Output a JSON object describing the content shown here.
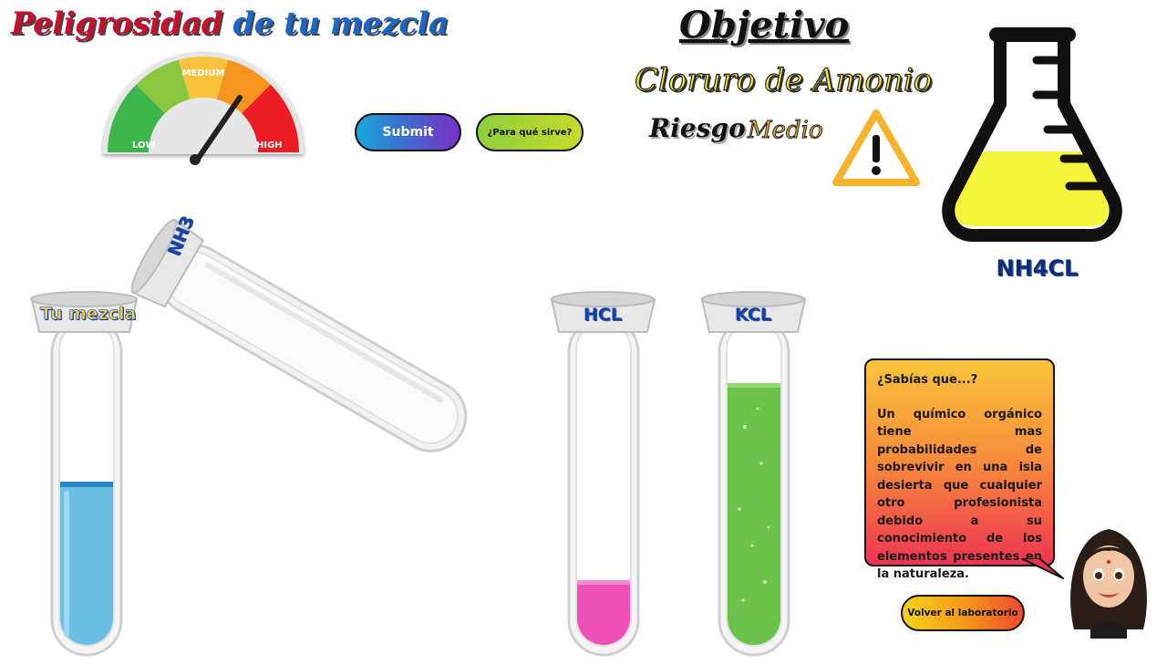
{
  "header": {
    "title_part1": "Peligrosidad",
    "title_part2": "de tu mezcla"
  },
  "gauge": {
    "label_low": "LOW",
    "label_medium": "MEDIUM",
    "label_high": "HIGH",
    "level": "medium-high",
    "colors": [
      "#3cb54a",
      "#8cc63f",
      "#f9c23c",
      "#f7941d",
      "#ed1c24"
    ]
  },
  "buttons": {
    "submit": "Submit",
    "info": "¿Para qué sirve?",
    "back": "Volver al laboratorio"
  },
  "objective": {
    "heading": "Objetivo",
    "compound": "Cloruro de Amonio",
    "risk_label": "Riesgo",
    "risk_value": "Medio",
    "warning_icon": "warning-triangle-icon",
    "flask_formula": "NH4CL",
    "flask_fill_color": "#f5f53c"
  },
  "tubes": {
    "mix": {
      "label": "Tu mezcla",
      "liquid_color": "#6bbfe3"
    },
    "nh3": {
      "label": "NH3"
    },
    "hcl": {
      "label": "HCL",
      "liquid_color": "#f04fb8"
    },
    "kcl": {
      "label": "KCL",
      "liquid_color": "#6cc24a"
    }
  },
  "fact": {
    "title": "¿Sabías que...?",
    "text": "Un químico orgánico tiene mas probabilidades de sobrevivir en una isla desierta que cualquier otro profesionista debido a su conocimiento de los elementos presentes en la naturaleza."
  }
}
